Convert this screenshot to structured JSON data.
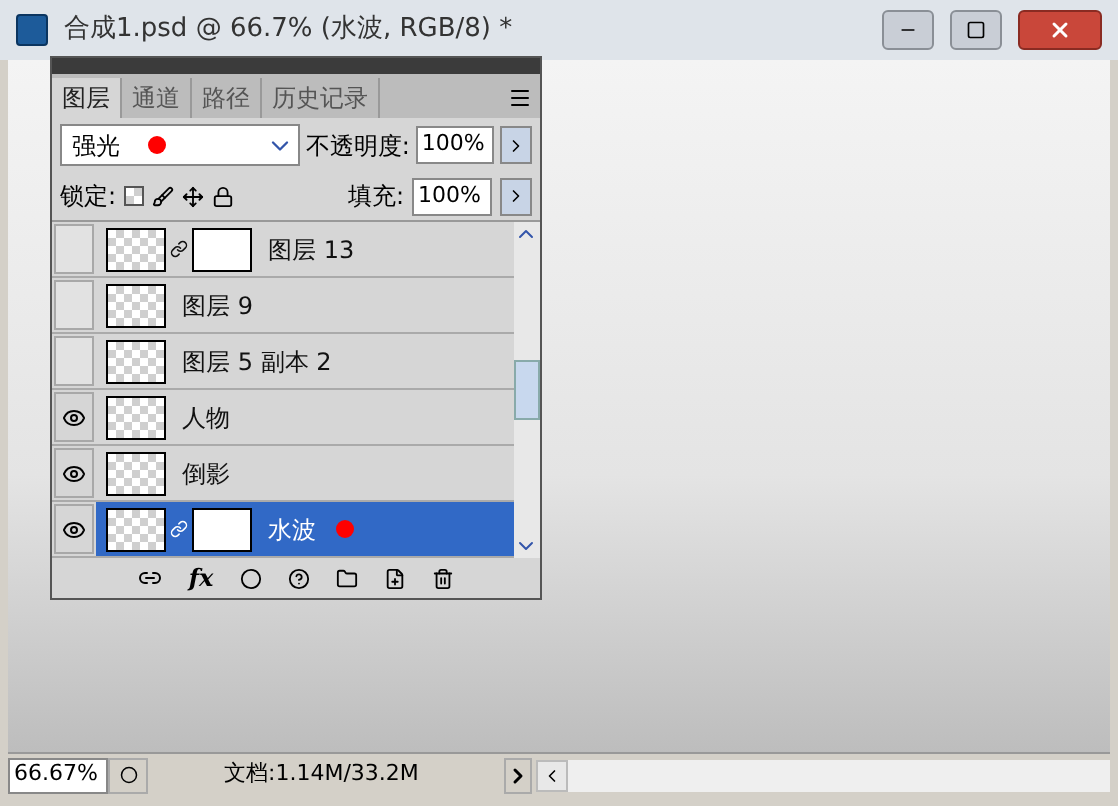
{
  "window": {
    "title": "合成1.psd @ 66.7% (水波, RGB/8) *"
  },
  "panel": {
    "tabs": [
      {
        "label": "图层",
        "selected": true
      },
      {
        "label": "通道",
        "selected": false
      },
      {
        "label": "路径",
        "selected": false
      },
      {
        "label": "历史记录",
        "selected": false
      }
    ],
    "blend_mode": {
      "value": "强光",
      "marker": true
    },
    "opacity": {
      "label": "不透明度:",
      "value": "100%"
    },
    "lock": {
      "label": "锁定:"
    },
    "fill": {
      "label": "填充:",
      "value": "100%"
    },
    "layers": [
      {
        "name": "图层 13",
        "visible": false,
        "selected": false,
        "mask": true,
        "marker": false
      },
      {
        "name": "图层 9",
        "visible": false,
        "selected": false,
        "mask": false,
        "marker": false
      },
      {
        "name": "图层 5 副本 2",
        "visible": false,
        "selected": false,
        "mask": false,
        "marker": false
      },
      {
        "name": "人物",
        "visible": true,
        "selected": false,
        "mask": false,
        "marker": false
      },
      {
        "name": "倒影",
        "visible": true,
        "selected": false,
        "mask": false,
        "marker": false
      },
      {
        "name": "水波",
        "visible": true,
        "selected": true,
        "mask": true,
        "marker": true
      }
    ],
    "fx_label": "fx"
  },
  "status_bar": {
    "zoom": "66.67%",
    "document": "文档:1.14M/33.2M"
  }
}
